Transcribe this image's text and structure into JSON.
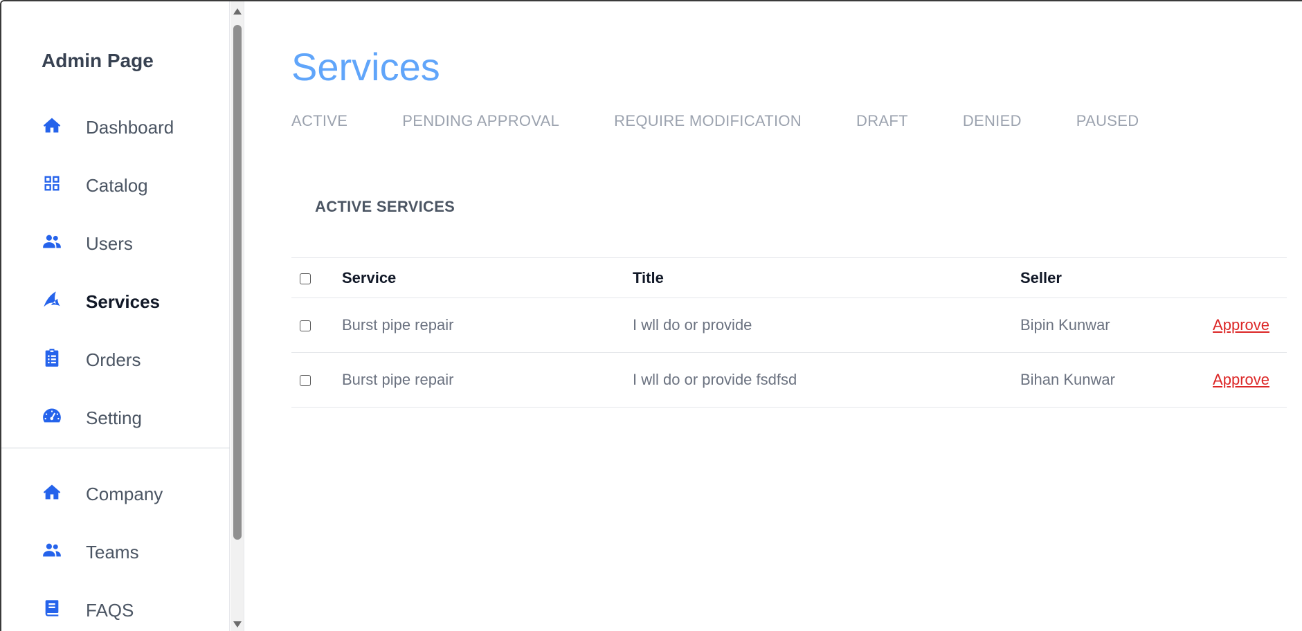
{
  "sidebar": {
    "brand": "Admin Page",
    "items": [
      {
        "label": "Dashboard",
        "icon": "home-icon"
      },
      {
        "label": "Catalog",
        "icon": "grid-icon"
      },
      {
        "label": "Users",
        "icon": "users-icon"
      },
      {
        "label": "Services",
        "icon": "services-icon",
        "active": true
      },
      {
        "label": "Orders",
        "icon": "clipboard-icon"
      },
      {
        "label": "Setting",
        "icon": "gauge-icon"
      }
    ],
    "secondary_items": [
      {
        "label": "Company",
        "icon": "home-icon"
      },
      {
        "label": "Teams",
        "icon": "users-icon"
      },
      {
        "label": "FAQS",
        "icon": "book-icon"
      }
    ]
  },
  "main": {
    "title": "Services",
    "tabs": [
      "ACTIVE",
      "PENDING APPROVAL",
      "REQUIRE MODIFICATION",
      "DRAFT",
      "DENIED",
      "PAUSED"
    ],
    "section_title": "ACTIVE SERVICES",
    "table": {
      "columns": [
        "Service",
        "Title",
        "Seller"
      ],
      "rows": [
        {
          "service": "Burst pipe repair",
          "title": "I wll do or provide",
          "seller": "Bipin Kunwar",
          "action": "Approve"
        },
        {
          "service": "Burst pipe repair",
          "title": "I wll do or provide fsdfsd",
          "seller": "Bihan Kunwar",
          "action": "Approve"
        }
      ]
    }
  },
  "colors": {
    "accent": "#2563eb",
    "title": "#60a5fa",
    "approve": "#dc2626"
  }
}
